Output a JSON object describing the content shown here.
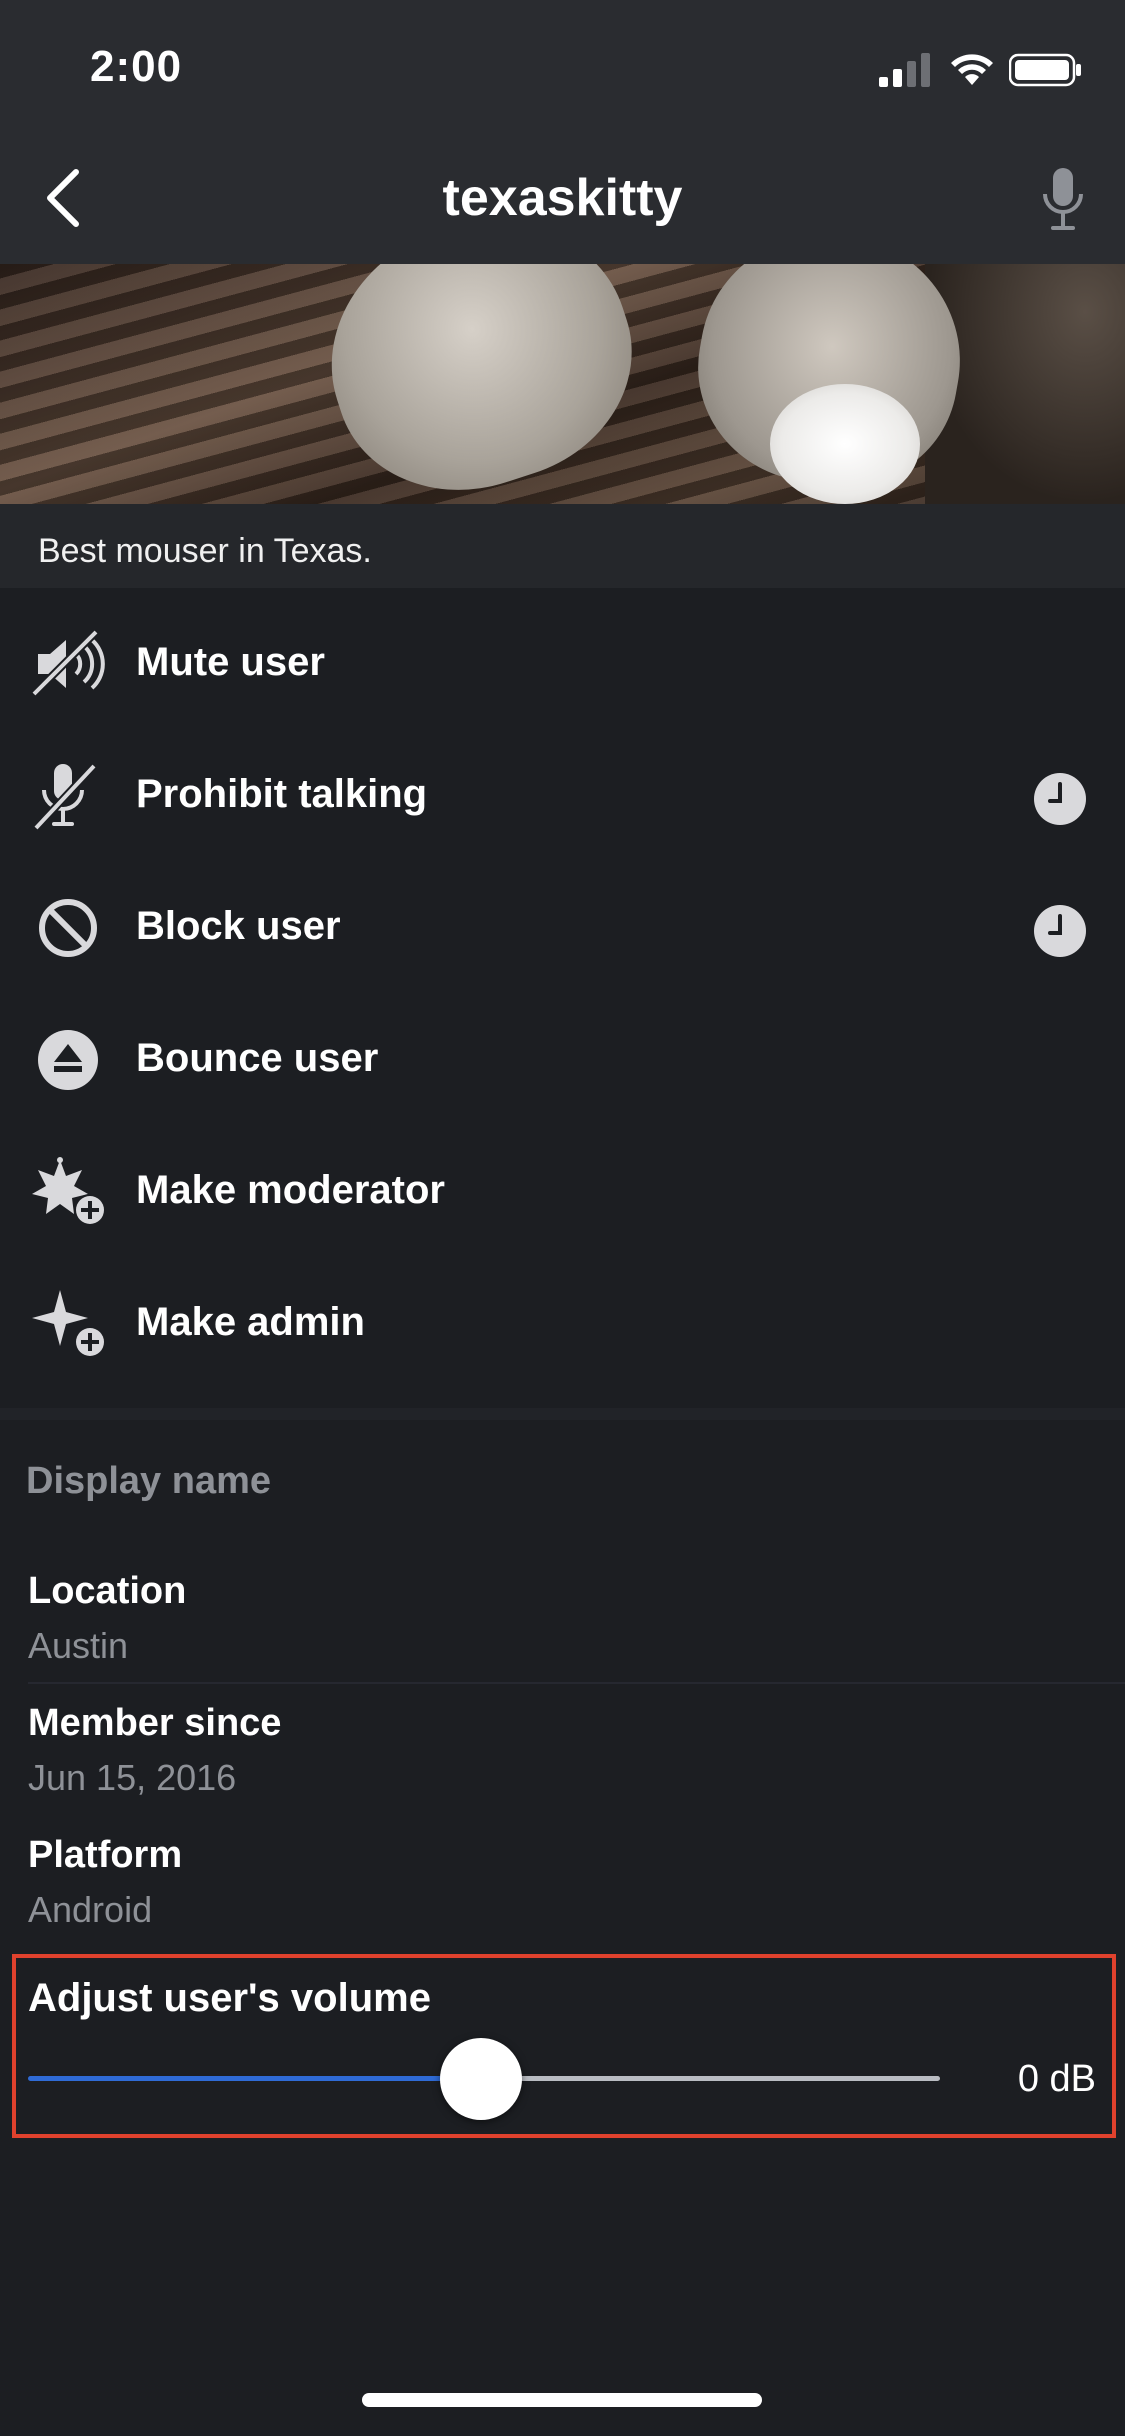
{
  "status_bar": {
    "time": "2:00"
  },
  "nav": {
    "title": "texaskitty",
    "back_icon": "chevron-left-icon",
    "mic_icon": "microphone-icon"
  },
  "profile": {
    "bio": "Best mouser in Texas."
  },
  "actions": [
    {
      "label": "Mute user",
      "icon": "speaker-muted-icon",
      "has_timer": false
    },
    {
      "label": "Prohibit talking",
      "icon": "microphone-off-icon",
      "has_timer": true
    },
    {
      "label": "Block user",
      "icon": "block-icon",
      "has_timer": true
    },
    {
      "label": "Bounce user",
      "icon": "eject-icon",
      "has_timer": false
    },
    {
      "label": "Make moderator",
      "icon": "sheriff-badge-plus-icon",
      "has_timer": false
    },
    {
      "label": "Make admin",
      "icon": "star-plus-icon",
      "has_timer": false
    }
  ],
  "details": {
    "section_title": "Display name",
    "location": {
      "label": "Location",
      "value": "Austin"
    },
    "member_since": {
      "label": "Member since",
      "value": "Jun 15, 2016"
    },
    "platform": {
      "label": "Platform",
      "value": "Android"
    }
  },
  "volume": {
    "label": "Adjust user's volume",
    "value": "0 dB",
    "level_fraction": 0.5
  },
  "colors": {
    "background": "#1c1e22",
    "accent": "#2f6bd6",
    "highlight": "#e0412d",
    "muted_text": "#8e9197"
  }
}
